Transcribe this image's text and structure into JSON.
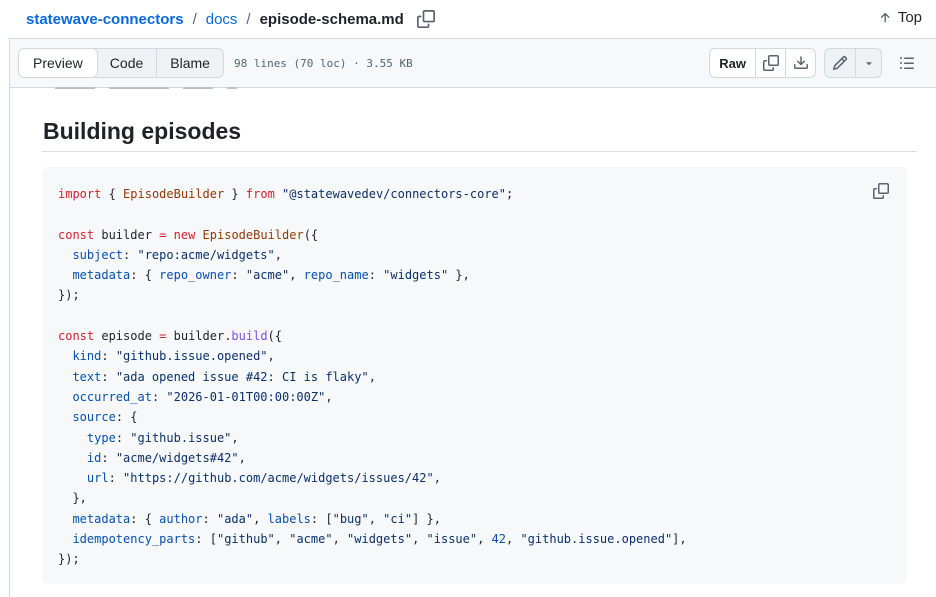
{
  "breadcrumb": {
    "repo": "statewave-connectors",
    "folder": "docs",
    "file": "episode-schema.md",
    "separator": "/"
  },
  "top_link": "Top",
  "toolbar": {
    "tabs": [
      {
        "label": "Preview",
        "active": true
      },
      {
        "label": "Code",
        "active": false
      },
      {
        "label": "Blame",
        "active": false
      }
    ],
    "file_meta": "98 lines (70 loc) · 3.55 KB",
    "raw_label": "Raw"
  },
  "icons": {
    "copy_path": "copy-icon",
    "top": "arrow-up-icon",
    "copy_raw": "copy-icon",
    "download": "download-icon",
    "edit": "pencil-icon",
    "more": "triangle-down-icon",
    "symbols": "list-unordered-icon",
    "code_copy": "copy-icon"
  },
  "markdown": {
    "heading": "Building episodes"
  },
  "code": {
    "language": "typescript",
    "lines": [
      [
        {
          "t": "import",
          "c": "kw"
        },
        {
          "t": " { "
        },
        {
          "t": "EpisodeBuilder",
          "c": "cls"
        },
        {
          "t": " } "
        },
        {
          "t": "from",
          "c": "kw"
        },
        {
          "t": " "
        },
        {
          "t": "\"@statewavedev/connectors-core\"",
          "c": "str"
        },
        {
          "t": ";"
        }
      ],
      [],
      [
        {
          "t": "const",
          "c": "kw"
        },
        {
          "t": " builder "
        },
        {
          "t": "=",
          "c": "kw"
        },
        {
          "t": " "
        },
        {
          "t": "new",
          "c": "kw"
        },
        {
          "t": " "
        },
        {
          "t": "EpisodeBuilder",
          "c": "cls"
        },
        {
          "t": "({"
        }
      ],
      [
        {
          "t": "  "
        },
        {
          "t": "subject",
          "c": "prop"
        },
        {
          "t": ": "
        },
        {
          "t": "\"repo:acme/widgets\"",
          "c": "str"
        },
        {
          "t": ","
        }
      ],
      [
        {
          "t": "  "
        },
        {
          "t": "metadata",
          "c": "prop"
        },
        {
          "t": ": { "
        },
        {
          "t": "repo_owner",
          "c": "prop"
        },
        {
          "t": ": "
        },
        {
          "t": "\"acme\"",
          "c": "str"
        },
        {
          "t": ", "
        },
        {
          "t": "repo_name",
          "c": "prop"
        },
        {
          "t": ": "
        },
        {
          "t": "\"widgets\"",
          "c": "str"
        },
        {
          "t": " },"
        }
      ],
      [
        {
          "t": "});"
        }
      ],
      [],
      [
        {
          "t": "const",
          "c": "kw"
        },
        {
          "t": " episode "
        },
        {
          "t": "=",
          "c": "kw"
        },
        {
          "t": " builder."
        },
        {
          "t": "build",
          "c": "fn"
        },
        {
          "t": "({"
        }
      ],
      [
        {
          "t": "  "
        },
        {
          "t": "kind",
          "c": "prop"
        },
        {
          "t": ": "
        },
        {
          "t": "\"github.issue.opened\"",
          "c": "str"
        },
        {
          "t": ","
        }
      ],
      [
        {
          "t": "  "
        },
        {
          "t": "text",
          "c": "prop"
        },
        {
          "t": ": "
        },
        {
          "t": "\"ada opened issue #42: CI is flaky\"",
          "c": "str"
        },
        {
          "t": ","
        }
      ],
      [
        {
          "t": "  "
        },
        {
          "t": "occurred_at",
          "c": "prop"
        },
        {
          "t": ": "
        },
        {
          "t": "\"2026-01-01T00:00:00Z\"",
          "c": "str"
        },
        {
          "t": ","
        }
      ],
      [
        {
          "t": "  "
        },
        {
          "t": "source",
          "c": "prop"
        },
        {
          "t": ": {"
        }
      ],
      [
        {
          "t": "    "
        },
        {
          "t": "type",
          "c": "prop"
        },
        {
          "t": ": "
        },
        {
          "t": "\"github.issue\"",
          "c": "str"
        },
        {
          "t": ","
        }
      ],
      [
        {
          "t": "    "
        },
        {
          "t": "id",
          "c": "prop"
        },
        {
          "t": ": "
        },
        {
          "t": "\"acme/widgets#42\"",
          "c": "str"
        },
        {
          "t": ","
        }
      ],
      [
        {
          "t": "    "
        },
        {
          "t": "url",
          "c": "prop"
        },
        {
          "t": ": "
        },
        {
          "t": "\"https://github.com/acme/widgets/issues/42\"",
          "c": "str"
        },
        {
          "t": ","
        }
      ],
      [
        {
          "t": "  },"
        }
      ],
      [
        {
          "t": "  "
        },
        {
          "t": "metadata",
          "c": "prop"
        },
        {
          "t": ": { "
        },
        {
          "t": "author",
          "c": "prop"
        },
        {
          "t": ": "
        },
        {
          "t": "\"ada\"",
          "c": "str"
        },
        {
          "t": ", "
        },
        {
          "t": "labels",
          "c": "prop"
        },
        {
          "t": ": ["
        },
        {
          "t": "\"bug\"",
          "c": "str"
        },
        {
          "t": ", "
        },
        {
          "t": "\"ci\"",
          "c": "str"
        },
        {
          "t": "] },"
        }
      ],
      [
        {
          "t": "  "
        },
        {
          "t": "idempotency_parts",
          "c": "prop"
        },
        {
          "t": ": ["
        },
        {
          "t": "\"github\"",
          "c": "str"
        },
        {
          "t": ", "
        },
        {
          "t": "\"acme\"",
          "c": "str"
        },
        {
          "t": ", "
        },
        {
          "t": "\"widgets\"",
          "c": "str"
        },
        {
          "t": ", "
        },
        {
          "t": "\"issue\"",
          "c": "str"
        },
        {
          "t": ", "
        },
        {
          "t": "42",
          "c": "num"
        },
        {
          "t": ", "
        },
        {
          "t": "\"github.issue.opened\"",
          "c": "str"
        },
        {
          "t": "],"
        }
      ],
      [
        {
          "t": "});"
        }
      ]
    ]
  },
  "colors": {
    "link": "#0969da",
    "keyword": "#cf222e",
    "string": "#0a3069",
    "class": "#953800",
    "function": "#8250df",
    "property": "#0550ae",
    "code_background": "#f6f8fa",
    "border": "#d1d9e0"
  }
}
